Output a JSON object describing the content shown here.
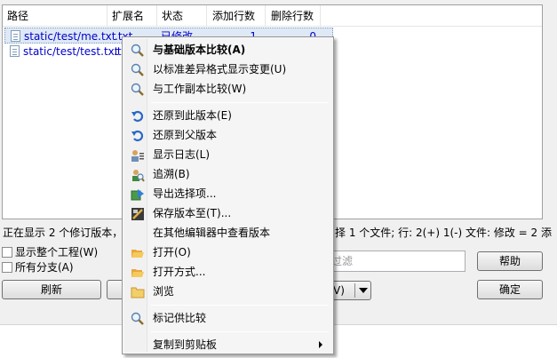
{
  "columns": {
    "path": "路径",
    "extension": "扩展名",
    "status": "状态",
    "added_lines": "添加行数",
    "deleted_lines": "删除行数"
  },
  "files": [
    {
      "path": "static/test/me.txt",
      "extension": ".txt",
      "status": "已修改",
      "added": "1",
      "deleted": "0"
    },
    {
      "path": "static/test/test.txt",
      "extension": ".txt",
      "status": "",
      "added": "",
      "deleted": ""
    }
  ],
  "status_bar": {
    "revisions_text": "正在显示 2 个修订版本，",
    "selection_text": "择 1 个文件; 行: 2(+) 1(-) 文件: 修改 = 2 添"
  },
  "options": {
    "show_whole_project": "显示整个工程(W)",
    "all_branches": "所有分支(A)"
  },
  "filter": {
    "placeholder": "过滤"
  },
  "buttons": {
    "refresh": "刷新",
    "help": "帮助",
    "ok": "确定",
    "split_label": "V)"
  },
  "context_menu": {
    "items": [
      {
        "label": "与基础版本比较(A)",
        "icon": "compare-icon"
      },
      {
        "label": "以标准差异格式显示变更(U)",
        "icon": "compare-icon"
      },
      {
        "label": "与工作副本比较(W)",
        "icon": "compare-icon"
      },
      {
        "label": "还原到此版本(E)",
        "icon": "revert-icon"
      },
      {
        "label": "还原到父版本",
        "icon": "revert-icon"
      },
      {
        "label": "显示日志(L)",
        "icon": "log-icon"
      },
      {
        "label": "追溯(B)",
        "icon": "blame-icon"
      },
      {
        "label": "导出选择项...",
        "icon": "export-icon"
      },
      {
        "label": "保存版本至(T)...",
        "icon": "save-icon"
      },
      {
        "label": "在其他编辑器中查看版本",
        "icon": ""
      },
      {
        "label": "打开(O)",
        "icon": "open-folder-icon"
      },
      {
        "label": "打开方式...",
        "icon": "open-folder-icon"
      },
      {
        "label": "浏览",
        "icon": "folder-icon"
      },
      {
        "label": "标记供比较",
        "icon": "compare-icon"
      },
      {
        "label": "复制到剪贴板",
        "icon": ""
      }
    ]
  },
  "colors": {
    "link_blue": "#0000cc",
    "menu_background": "#f5f5f5",
    "selection": "#dfe9f5"
  }
}
